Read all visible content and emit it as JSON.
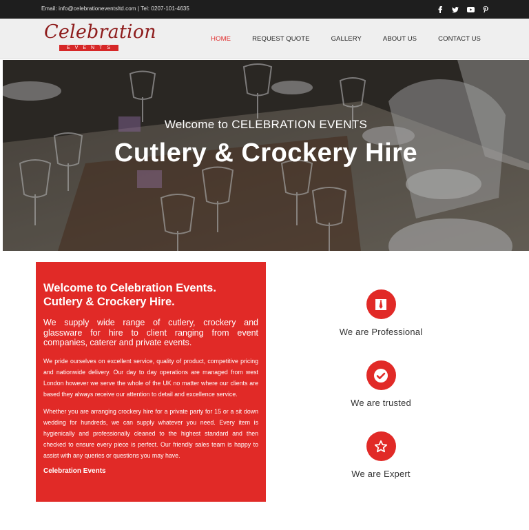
{
  "topbar": {
    "contact": "Email: info@celebrationeventsltd.com | Tel: 0207-101-4635",
    "socials": [
      "facebook-icon",
      "twitter-icon",
      "youtube-icon",
      "pinterest-icon"
    ]
  },
  "logo": {
    "script": "Celebration",
    "strip": "EVENTS"
  },
  "nav": {
    "items": [
      {
        "label": "HOME"
      },
      {
        "label": "REQUEST QUOTE"
      },
      {
        "label": "GALLERY"
      },
      {
        "label": "ABOUT US"
      },
      {
        "label": "CONTACT US"
      }
    ],
    "active_color": "#e02a2a"
  },
  "hero": {
    "subtitle": "Welcome to CELEBRATION EVENTS",
    "title": "Cutlery & Crockery Hire"
  },
  "intro": {
    "heading": "Welcome to Celebration Events. Cutlery & Crockery Hire.",
    "lead": "We supply wide range of cutlery, crockery and glassware for hire to client ranging from event companies, caterer and private events.",
    "para1": "We pride ourselves on excellent service, quality of product, competitive pricing and nationwide delivery. Our day to day operations are managed from west London however we serve the whole of the UK no matter where our clients are based they always receive our attention to detail and excellence service.",
    "para2": "Whether you are arranging crockery hire for a private party for 15 or a sit down wedding for hundreds, we can supply whatever you need. Every item is hygienically and professionally cleaned to the highest standard and then checked to ensure every piece is perfect. Our friendly sales team is happy to assist with any queries or questions you may have.",
    "signature": "Celebration Events",
    "background": "#e12a27"
  },
  "features": [
    {
      "icon": "tie-icon",
      "label": "We are Professional"
    },
    {
      "icon": "checkmark-icon",
      "label": "We are trusted"
    },
    {
      "icon": "star-icon",
      "label": "We are Expert"
    }
  ]
}
